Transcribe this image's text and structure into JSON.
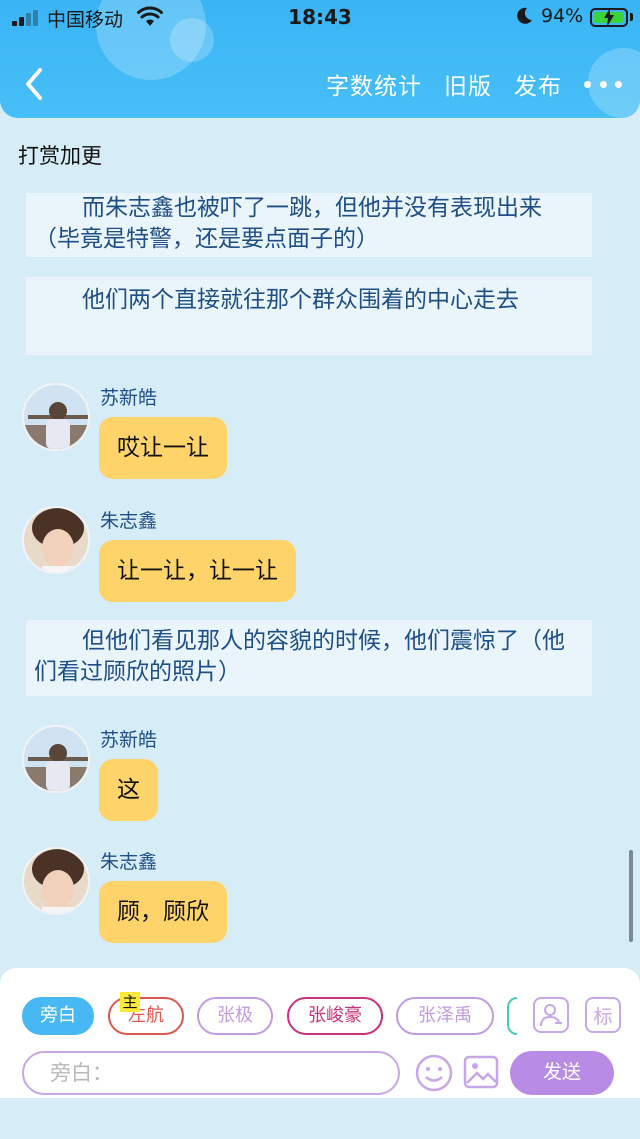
{
  "status_bar": {
    "carrier": "中国移动",
    "time": "18:43",
    "battery_percent": "94%"
  },
  "header": {
    "back_icon": "chevron-left-icon",
    "word_count": "字数统计",
    "old_version": "旧版",
    "publish": "发布",
    "more_icon": "more-dots-icon"
  },
  "chapter": {
    "title": "打赏加更"
  },
  "content": {
    "narration_1": "而朱志鑫也被吓了一跳，但他并没有表现出来（毕竟是特警，还是要点面子的）",
    "narration_2": "他们两个直接就往那个群众围着的中心走去",
    "msg_1": {
      "sender": "苏新皓",
      "text": "哎让一让"
    },
    "msg_2": {
      "sender": "朱志鑫",
      "text": "让一让，让一让"
    },
    "narration_3": "但他们看见那人的容貌的时候，他们震惊了（他们看过顾欣的照片）",
    "msg_3": {
      "sender": "苏新皓",
      "text": "这"
    },
    "msg_4": {
      "sender": "朱志鑫",
      "text": "顾，顾欣"
    }
  },
  "composer": {
    "roles": [
      {
        "label": "旁白",
        "color": "#48b8f5"
      },
      {
        "label": "左航",
        "color": "#e0574f"
      },
      {
        "label": "张极",
        "color": "#c39be0"
      },
      {
        "label": "张峻豪",
        "color": "#c8327a"
      },
      {
        "label": "张泽禹",
        "color": "#c39be0"
      }
    ],
    "host_badge": "主",
    "mark_label": "标",
    "input_placeholder": "旁白：",
    "send_label": "发送"
  },
  "colors": {
    "header": "#3ab4f5",
    "background": "#d6ecf7",
    "bubble": "#fdd36a",
    "narration_text": "#1f4f86",
    "accent_purple": "#b88be4"
  }
}
